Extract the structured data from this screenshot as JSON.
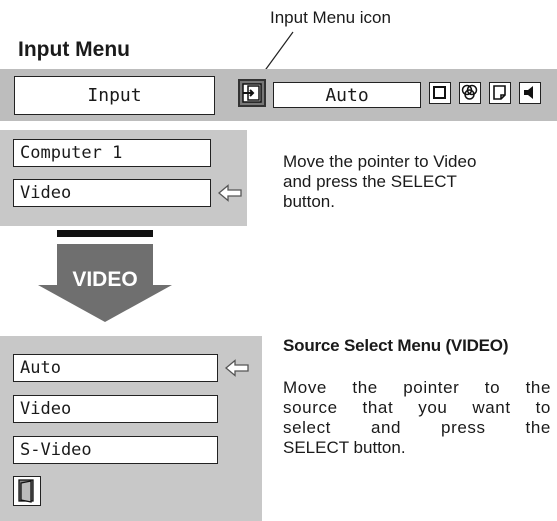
{
  "callout": {
    "label": "Input Menu icon"
  },
  "heading": "Input Menu",
  "menubar": {
    "title": "Input",
    "mode_value": "Auto",
    "icons": [
      "input-icon",
      "square-icon",
      "color-wheel-icon",
      "page-icon",
      "speaker-icon"
    ]
  },
  "input_menu": {
    "items": [
      "Computer 1",
      "Video"
    ],
    "pointer_at": "Video"
  },
  "instruction_1": {
    "lines": [
      "Move the pointer to Video",
      "and press the SELECT",
      "button."
    ]
  },
  "transition": {
    "label": "VIDEO"
  },
  "source_menu": {
    "items": [
      "Auto",
      "Video",
      "S-Video"
    ],
    "pointer_at": "Auto",
    "exit_icon": "door-exit-icon"
  },
  "instruction_2": {
    "title": "Source Select Menu (VIDEO)",
    "lines": [
      "Move the pointer to the",
      "source that you want to",
      "select and press the",
      "SELECT button."
    ]
  },
  "colors": {
    "panel": "#c8c8c8",
    "menubar": "#bdbdbd",
    "arrow": "#6f6f6f"
  }
}
